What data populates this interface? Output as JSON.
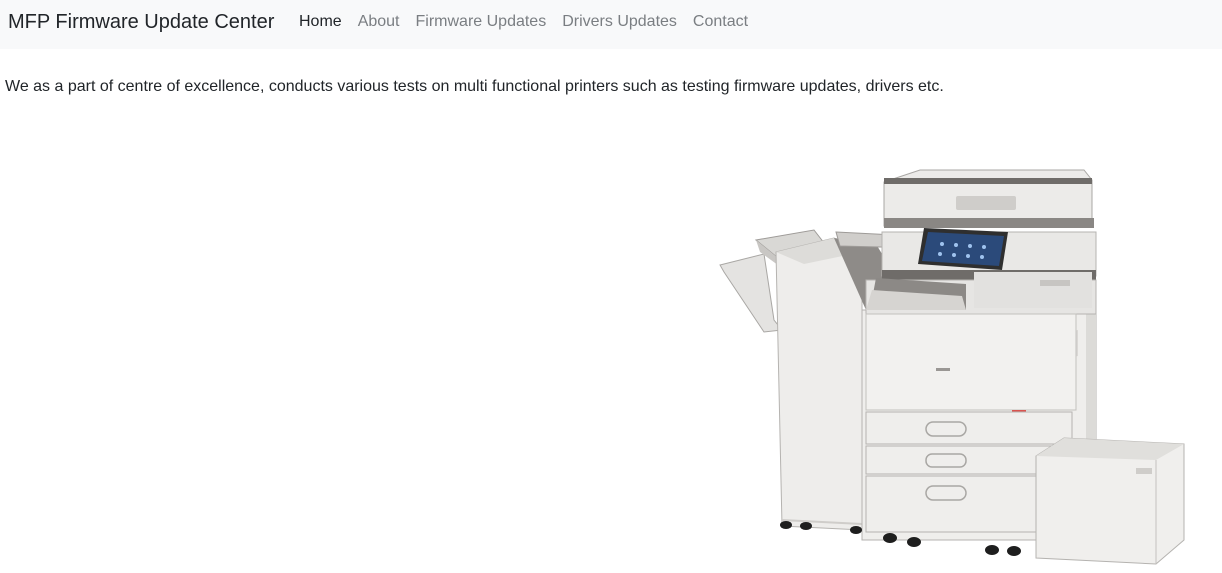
{
  "navbar": {
    "brand": "MFP Firmware Update Center",
    "links": [
      {
        "label": "Home",
        "active": true
      },
      {
        "label": "About",
        "active": false
      },
      {
        "label": "Firmware Updates",
        "active": false
      },
      {
        "label": "Drivers Updates",
        "active": false
      },
      {
        "label": "Contact",
        "active": false
      }
    ]
  },
  "main": {
    "intro_text": "We as a part of centre of excellence, conducts various tests on multi functional printers such as testing firmware updates, drivers etc.",
    "image_subject": "multifunction-printer"
  },
  "colors": {
    "navbar_bg": "#f8f9fa",
    "active_link": "#212529",
    "inactive_link": "#7a7e82",
    "printer_body": "#ececea",
    "printer_trim": "#8a8784",
    "touch_panel": "#2b4a7a"
  }
}
